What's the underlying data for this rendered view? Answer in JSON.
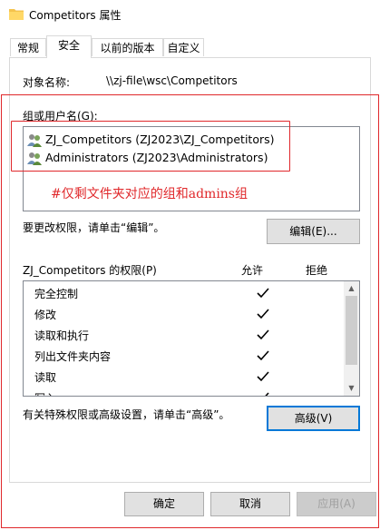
{
  "window": {
    "title": "Competitors 属性"
  },
  "tabs": [
    {
      "label": "常规"
    },
    {
      "label": "安全"
    },
    {
      "label": "以前的版本"
    },
    {
      "label": "自定义"
    }
  ],
  "security": {
    "object_label": "对象名称:",
    "object_value": "\\\\zj-file\\wsc\\Competitors",
    "groups_label": "组或用户名(G):",
    "groups": [
      {
        "name": "ZJ_Competitors (ZJ2023\\ZJ_Competitors)"
      },
      {
        "name": "Administrators (ZJ2023\\Administrators)"
      }
    ],
    "annotation": "#仅剩文件夹对应的组和admins组",
    "edit_hint": "要更改权限，请单击“编辑”。",
    "edit_button": "编辑(E)...",
    "perm_title": "ZJ_Competitors 的权限(P)",
    "allow_header": "允许",
    "deny_header": "拒绝",
    "permissions": [
      {
        "name": "完全控制",
        "allow": true
      },
      {
        "name": "修改",
        "allow": true
      },
      {
        "name": "读取和执行",
        "allow": true
      },
      {
        "name": "列出文件夹内容",
        "allow": true
      },
      {
        "name": "读取",
        "allow": true
      },
      {
        "name": "写入",
        "allow": true
      }
    ],
    "advanced_hint": "有关特殊权限或高级设置，请单击“高级”。",
    "advanced_button": "高级(V)"
  },
  "footer": {
    "ok": "确定",
    "cancel": "取消",
    "apply": "应用(A)"
  },
  "colors": {
    "annotation": "#e0282b",
    "focus": "#0078d7"
  }
}
